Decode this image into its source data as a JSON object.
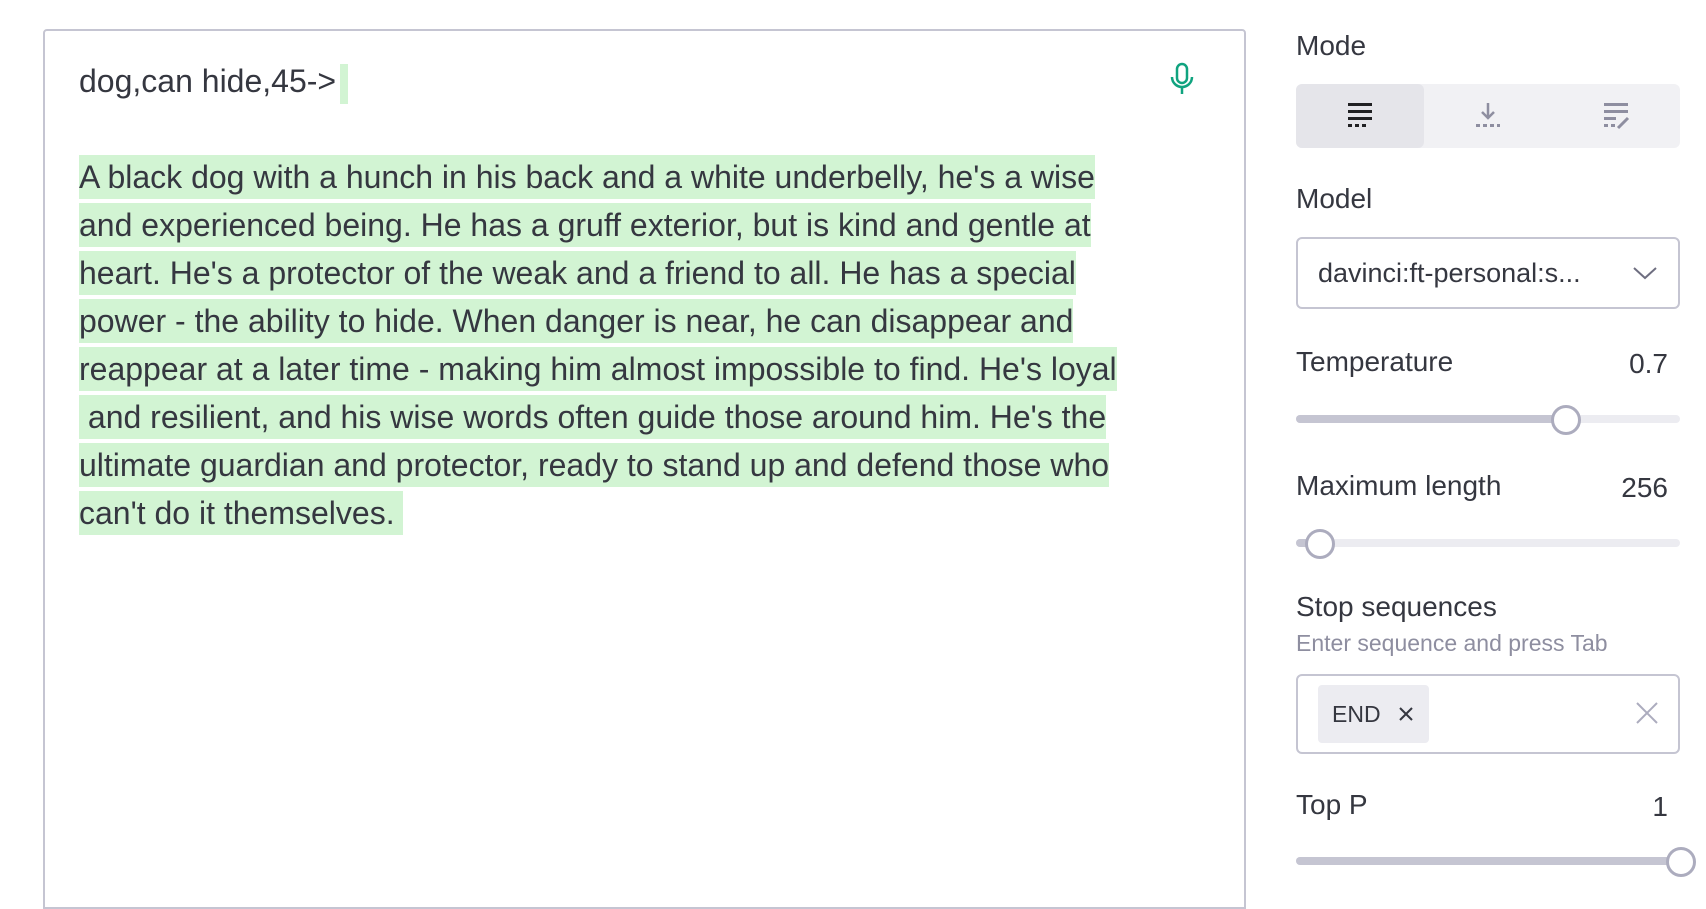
{
  "editor": {
    "prompt": "dog,can hide,45->",
    "completion_lines": [
      "A black dog with a hunch in his back and a white underbelly, he's a wise",
      "and experienced being. He has a gruff exterior, but is kind and gentle at",
      "heart. He's a protector of the weak and a friend to all. He has a special",
      "power - the ability to hide. When danger is near, he can disappear and",
      "reappear at a later time - making him almost impossible to find. He's loyal",
      " and resilient, and his wise words often guide those around him. He's the",
      "ultimate guardian and protector, ready to stand up and defend those who",
      "can't do it themselves. "
    ],
    "highlight_color": "#d2f4d3",
    "mic_icon": "microphone-icon"
  },
  "settings": {
    "mode": {
      "label": "Mode",
      "options": [
        {
          "icon": "complete-mode-icon",
          "active": true
        },
        {
          "icon": "insert-mode-icon",
          "active": false
        },
        {
          "icon": "edit-mode-icon",
          "active": false
        }
      ]
    },
    "model": {
      "label": "Model",
      "value": "davinci:ft-personal:s..."
    },
    "temperature": {
      "label": "Temperature",
      "value": "0.7",
      "fraction": 0.7
    },
    "max_length": {
      "label": "Maximum length",
      "value": "256",
      "fraction": 0.06
    },
    "stop_sequences": {
      "label": "Stop sequences",
      "hint": "Enter sequence and press Tab",
      "chips": [
        "END"
      ]
    },
    "top_p": {
      "label": "Top P",
      "value": "1",
      "fraction": 1.0
    }
  },
  "colors": {
    "accent_green": "#10a37f",
    "text": "#353740",
    "muted": "#8e8ea0"
  }
}
